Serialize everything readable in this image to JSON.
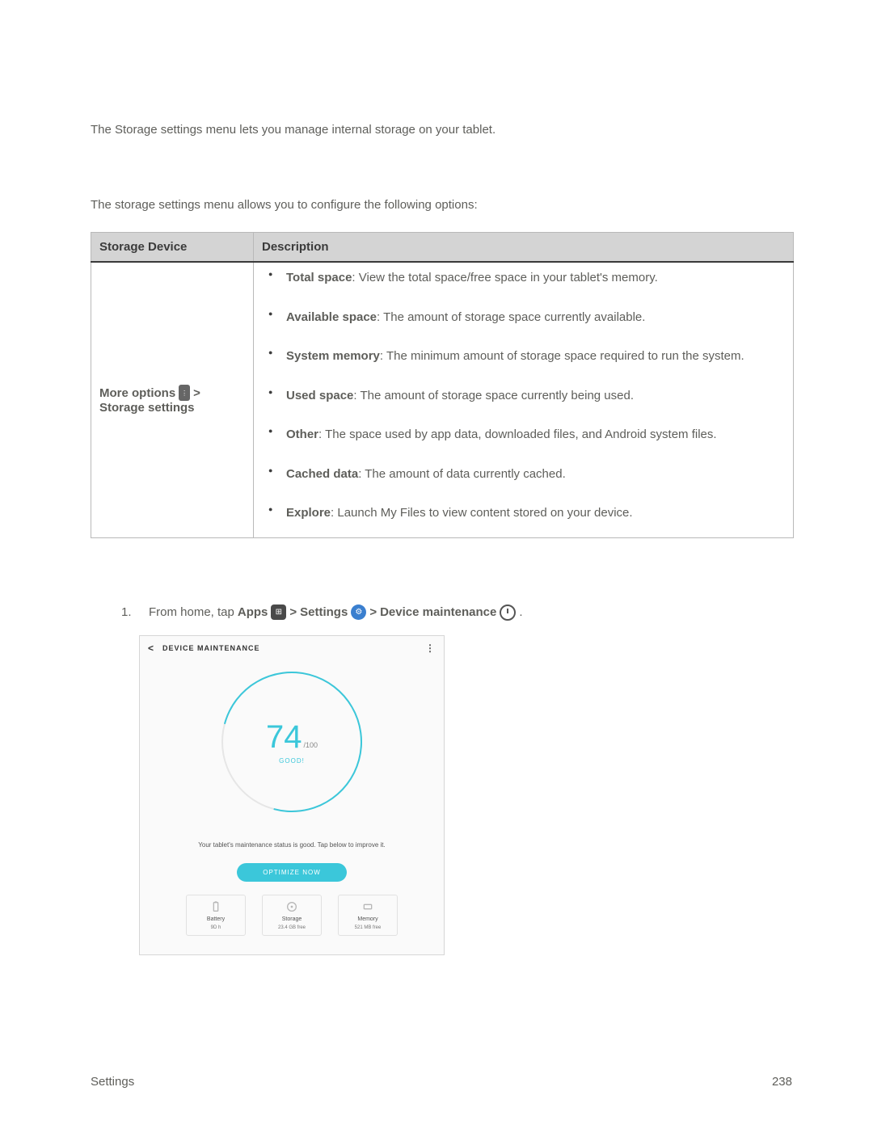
{
  "intro": "The Storage settings menu lets you manage internal storage on your tablet.",
  "overview": "The storage settings menu allows you to configure the following options:",
  "table": {
    "headers": {
      "c1": "Storage Device",
      "c2": "Description"
    },
    "row": {
      "more_options": "More options",
      "sep": " > ",
      "storage_settings": "Storage settings",
      "items": [
        {
          "k": "Total space",
          "v": ": View the total space/free space in your tablet's memory."
        },
        {
          "k": "Available space",
          "v": ": The amount of storage space currently available."
        },
        {
          "k": "System memory",
          "v": ": The minimum amount of storage space required to run the system."
        },
        {
          "k": "Used space",
          "v": ": The amount of storage space currently being used."
        },
        {
          "k": "Other",
          "v": ": The space used by app data, downloaded files, and Android system files."
        },
        {
          "k": "Cached data",
          "v": ": The amount of data currently cached."
        },
        {
          "k": "Explore",
          "v": ": Launch My Files to view content stored on your device."
        }
      ]
    }
  },
  "step": {
    "num": "1.",
    "pre": "From home, tap ",
    "apps": "Apps",
    "settings": "Settings",
    "maint": "Device maintenance",
    "sep": " > ",
    "end": "."
  },
  "mock": {
    "title": "DEVICE MAINTENANCE",
    "score": "74",
    "outof": "/100",
    "good": "GOOD!",
    "tip": "Your tablet's maintenance status is good. Tap below to improve it.",
    "optimize": "OPTIMIZE NOW",
    "cats": [
      {
        "name": "Battery",
        "sub": "9D h"
      },
      {
        "name": "Storage",
        "sub": "23.4 GB free"
      },
      {
        "name": "Memory",
        "sub": "521 MB free"
      }
    ]
  },
  "footer": {
    "left": "Settings",
    "right": "238"
  }
}
